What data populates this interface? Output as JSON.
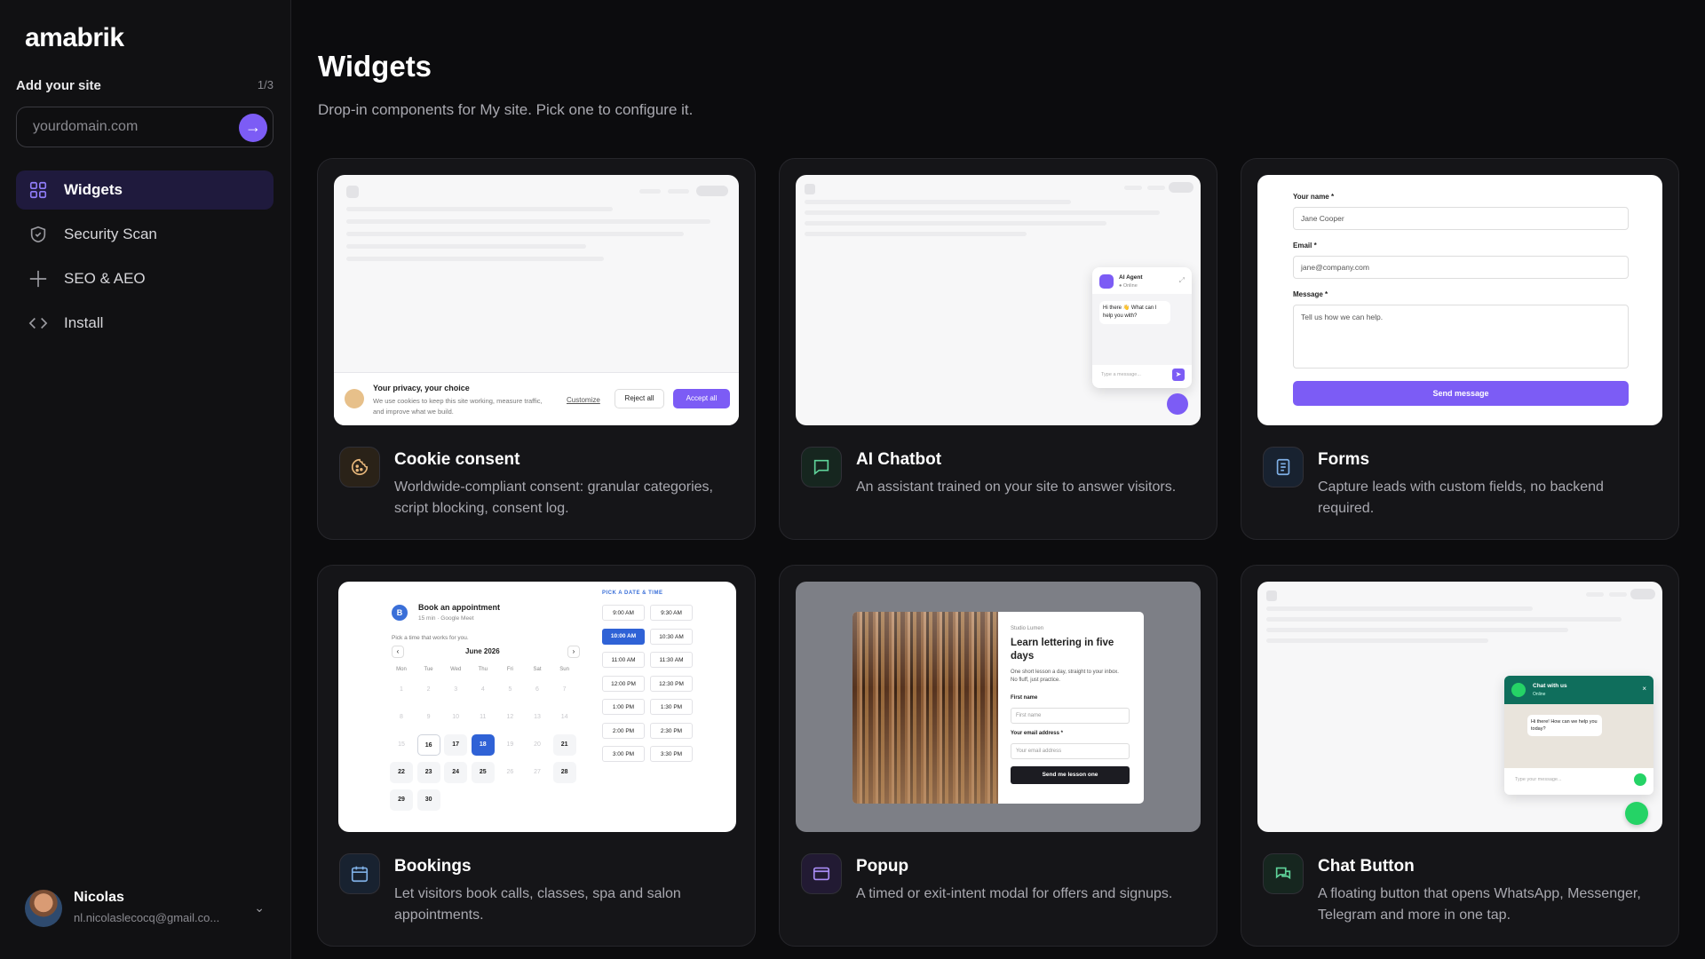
{
  "brand": {
    "name": "amabrik"
  },
  "addsite": {
    "label": "Add your site",
    "step": "1/3",
    "placeholder": "yourdomain.com"
  },
  "nav": [
    {
      "label": "Widgets",
      "icon": "grid-icon"
    },
    {
      "label": "Security Scan",
      "icon": "shield-icon"
    },
    {
      "label": "SEO & AEO",
      "icon": "sparkle-icon"
    },
    {
      "label": "Install",
      "icon": "code-icon"
    }
  ],
  "user": {
    "name": "Nicolas",
    "email": "nl.nicolaslecocq@gmail.co..."
  },
  "page": {
    "title": "Widgets",
    "subtitle": "Drop-in components for My site. Pick one to configure it."
  },
  "accent": "#7c5cf5",
  "cards": [
    {
      "title": "Cookie consent",
      "desc": "Worldwide-compliant consent: granular categories, script blocking, consent log.",
      "icon": "cookie-icon"
    },
    {
      "title": "AI Chatbot",
      "desc": "An assistant trained on your site to answer visitors.",
      "icon": "chat-bubble-icon"
    },
    {
      "title": "Forms",
      "desc": "Capture leads with custom fields, no backend required.",
      "icon": "form-icon"
    },
    {
      "title": "Bookings",
      "desc": "Let visitors book calls, classes, spa and salon appointments.",
      "icon": "calendar-icon"
    },
    {
      "title": "Popup",
      "desc": "A timed or exit-intent modal for offers and signups.",
      "icon": "window-icon"
    },
    {
      "title": "Chat Button",
      "desc": "A floating button that opens WhatsApp, Messenger, Telegram and more in one tap.",
      "icon": "chat-button-icon"
    }
  ],
  "cookie_preview": {
    "title": "Your privacy, your choice",
    "text": "We use cookies to keep this site working, measure traffic, and improve what we build.",
    "customize": "Customize",
    "reject": "Reject all",
    "accept": "Accept all"
  },
  "chatbot_preview": {
    "agent": "AI Agent",
    "status": "● Online",
    "greeting": "Hi there 👋 What can I help you with?",
    "placeholder": "Type a message..."
  },
  "forms_preview": {
    "name_label": "Your name *",
    "name_value": "Jane Cooper",
    "email_label": "Email *",
    "email_value": "jane@company.com",
    "message_label": "Message *",
    "message_placeholder": "Tell us how we can help.",
    "submit": "Send message"
  },
  "bookings_preview": {
    "avatar": "B",
    "title": "Book an appointment",
    "meta": "15 min · Google Meet",
    "prompt": "Pick a time that works for you.",
    "month": "June 2026",
    "pick_label": "PICK A DATE & TIME",
    "weekdays": [
      "Mon",
      "Tue",
      "Wed",
      "Thu",
      "Fri",
      "Sat",
      "Sun"
    ],
    "days": [
      "1",
      "2",
      "3",
      "4",
      "5",
      "6",
      "7",
      "8",
      "9",
      "10",
      "11",
      "12",
      "13",
      "14",
      "15",
      "16",
      "17",
      "18",
      "19",
      "20",
      "21",
      "22",
      "23",
      "24",
      "25",
      "26",
      "27",
      "28",
      "29",
      "30"
    ],
    "available": [
      "16",
      "17",
      "18",
      "21",
      "22",
      "23",
      "24",
      "25",
      "28",
      "29",
      "30"
    ],
    "selected": "18",
    "today": "16",
    "times": [
      "9:00 AM",
      "9:30 AM",
      "10:00 AM",
      "10:30 AM",
      "11:00 AM",
      "11:30 AM",
      "12:00 PM",
      "12:30 PM",
      "1:00 PM",
      "1:30 PM",
      "2:00 PM",
      "2:30 PM",
      "3:00 PM",
      "3:30 PM"
    ],
    "selected_time": "10:00 AM"
  },
  "popup_preview": {
    "brand": "Studio Lumen",
    "headline": "Learn lettering in five days",
    "text": "One short lesson a day, straight to your inbox. No fluff, just practice.",
    "first_label": "First name",
    "first_placeholder": "First name",
    "email_label": "Your email address *",
    "email_placeholder": "Your email address",
    "submit": "Send me lesson one"
  },
  "chatbutton_preview": {
    "title": "Chat with us",
    "status": "Online",
    "message": "Hi there! How can we help you today?",
    "placeholder": "Type your message..."
  }
}
